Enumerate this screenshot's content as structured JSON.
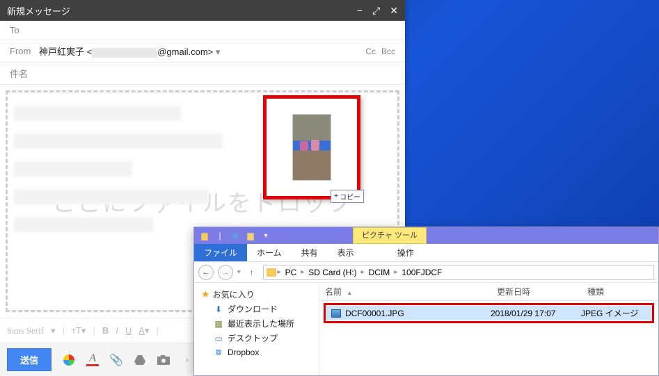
{
  "compose": {
    "title": "新規メッセージ",
    "to_label": "To",
    "from_label": "From",
    "from_name": "神戸紅実子",
    "from_email_suffix": "@gmail.com>",
    "cc_label": "Cc",
    "bcc_label": "Bcc",
    "subject_placeholder": "件名",
    "drop_hint": "ここにファイルをドロップ",
    "copy_badge": "コピー",
    "format_font": "Sans Serif",
    "send_label": "送信"
  },
  "explorer": {
    "picture_tools": "ピクチャ ツール",
    "tabs": {
      "file": "ファイル",
      "home": "ホーム",
      "share": "共有",
      "view": "表示",
      "manage": "操作"
    },
    "breadcrumb": [
      "PC",
      "SD Card (H:)",
      "DCIM",
      "100FJDCF"
    ],
    "fav_header": "お気に入り",
    "fav_items": [
      {
        "icon": "⬇",
        "label": "ダウンロード",
        "color": "#3a7ac0"
      },
      {
        "icon": "🕘",
        "label": "最近表示した場所",
        "color": "#7a8a3a"
      },
      {
        "icon": "🖥",
        "label": "デスクトップ",
        "color": "#4a7ab0"
      },
      {
        "icon": "⧈",
        "label": "Dropbox",
        "color": "#0061fe"
      }
    ],
    "columns": {
      "name": "名前",
      "date": "更新日時",
      "type": "種類"
    },
    "files": [
      {
        "name": "DCF00001.JPG",
        "date": "2018/01/29 17:07",
        "type": "JPEG イメージ"
      }
    ]
  }
}
